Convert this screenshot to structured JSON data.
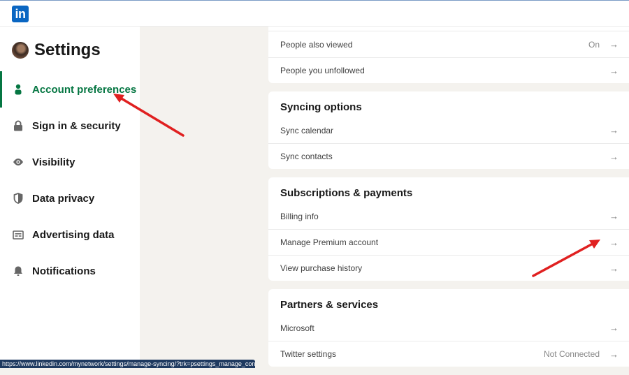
{
  "header": {
    "logo_text": "in",
    "logo_color": "#0a66c2"
  },
  "sidebar": {
    "title": "Settings",
    "items": [
      {
        "label": "Account preferences",
        "icon": "person-icon",
        "active": true
      },
      {
        "label": "Sign in & security",
        "icon": "lock-icon",
        "active": false
      },
      {
        "label": "Visibility",
        "icon": "eye-icon",
        "active": false
      },
      {
        "label": "Data privacy",
        "icon": "shield-icon",
        "active": false
      },
      {
        "label": "Advertising data",
        "icon": "ad-card-icon",
        "active": false
      },
      {
        "label": "Notifications",
        "icon": "bell-icon",
        "active": false
      }
    ],
    "accent_color": "#057642"
  },
  "main": {
    "sections": [
      {
        "title": "",
        "rows": [
          {
            "label": "People also viewed",
            "value": "On"
          },
          {
            "label": "People you unfollowed",
            "value": ""
          }
        ]
      },
      {
        "title": "Syncing options",
        "rows": [
          {
            "label": "Sync calendar",
            "value": ""
          },
          {
            "label": "Sync contacts",
            "value": ""
          }
        ]
      },
      {
        "title": "Subscriptions & payments",
        "rows": [
          {
            "label": "Billing info",
            "value": ""
          },
          {
            "label": "Manage Premium account",
            "value": ""
          },
          {
            "label": "View purchase history",
            "value": ""
          }
        ]
      },
      {
        "title": "Partners & services",
        "rows": [
          {
            "label": "Microsoft",
            "value": ""
          },
          {
            "label": "Twitter settings",
            "value": "Not Connected"
          }
        ]
      }
    ],
    "arrow_glyph": "→"
  },
  "status_bar": {
    "url": "https://www.linkedin.com/mynetwork/settings/manage-syncing/?trk=psettings_manage_con..."
  },
  "annotations": {
    "arrow_color": "#e02020"
  }
}
